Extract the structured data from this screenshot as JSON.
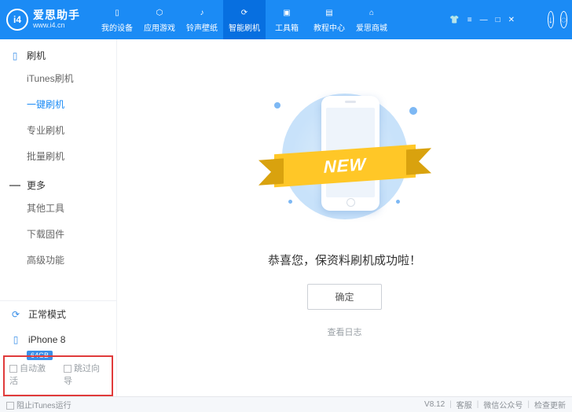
{
  "app": {
    "title": "爱思助手",
    "site": "www.i4.cn",
    "logo_letter": "i4"
  },
  "topnav": [
    {
      "label": "我的设备"
    },
    {
      "label": "应用游戏"
    },
    {
      "label": "铃声壁纸"
    },
    {
      "label": "智能刷机",
      "active": true
    },
    {
      "label": "工具箱"
    },
    {
      "label": "教程中心"
    },
    {
      "label": "爱思商城"
    }
  ],
  "sidebar": {
    "group1": {
      "title": "刷机",
      "items": [
        "iTunes刷机",
        "一键刷机",
        "专业刷机",
        "批量刷机"
      ],
      "active_index": 1
    },
    "group2": {
      "title": "更多",
      "items": [
        "其他工具",
        "下载固件",
        "高级功能"
      ]
    },
    "mode": "正常模式",
    "device": {
      "name": "iPhone 8",
      "badge": "64GB"
    },
    "checks": {
      "auto_activate": "自动激活",
      "skip_wizard": "跳过向导"
    }
  },
  "main": {
    "new_label": "NEW",
    "message": "恭喜您，保资料刷机成功啦！",
    "ok_button": "确定",
    "view_log": "查看日志"
  },
  "footer": {
    "block_itunes": "阻止iTunes运行",
    "version": "V8.12",
    "support": "客服",
    "wechat": "微信公众号",
    "update": "检查更新"
  }
}
